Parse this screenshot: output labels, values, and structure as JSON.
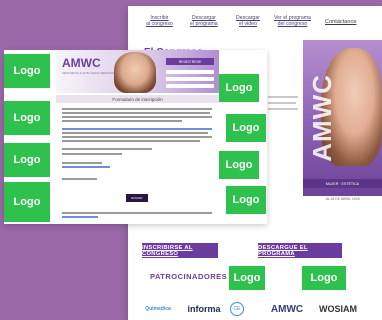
{
  "page": {
    "background": "#9b68a8"
  },
  "website": {
    "nav": [
      {
        "line1": "Inscribir",
        "line2": "al congreso"
      },
      {
        "line1": "Descargar",
        "line2": "el programa"
      },
      {
        "line1": "Descargar",
        "line2": "el video"
      },
      {
        "line1": "Ver el programa",
        "line2": "del congreso"
      }
    ],
    "contact_label": "Contáctanos",
    "heading": "El Congreso",
    "hero": {
      "wordmark": "AMWC",
      "strip_text": "MUJER · ESTÉTICA",
      "date": "16-18 DE ABRIL 2026"
    },
    "cta_register": "INSCRIBIRSE AL CONGRESO",
    "cta_download": "DESCARGUE EL PROGRAMA",
    "sponsors_label": "PATROCINADORES",
    "sponsors": [
      "Quimedica",
      "informa",
      "CE",
      "AMWC",
      "WOSIAM"
    ],
    "accent": "#6b3c9e"
  },
  "email": {
    "logo": "AMWC",
    "tagline": "AESTHETIC & ANTI-AGING MEDICINE",
    "badge": "REGÍSTRESE",
    "subheader": "Formulario de inscripción",
    "button_label": "ENVIAR"
  },
  "logo_placeholders": [
    "Logo",
    "Logo",
    "Logo",
    "Logo",
    "Logo",
    "Logo",
    "Logo",
    "Logo",
    "Logo",
    "Logo"
  ],
  "logo_color": "#2fc14d"
}
